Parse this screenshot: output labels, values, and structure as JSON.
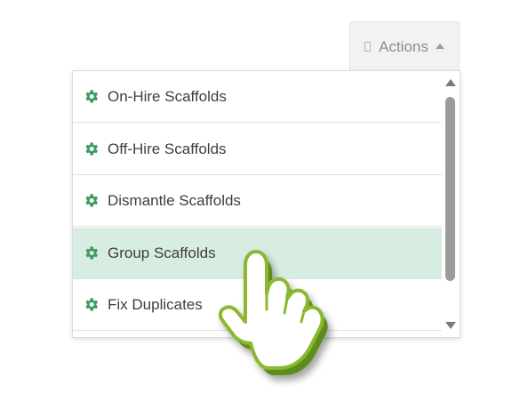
{
  "actions_button": {
    "label": "Actions",
    "icon": "document-icon",
    "caret": "caret-up-icon"
  },
  "menu": {
    "items": [
      {
        "label": "On-Hire Scaffolds",
        "icon": "gear-icon"
      },
      {
        "label": "Off-Hire Scaffolds",
        "icon": "gear-icon"
      },
      {
        "label": "Dismantle Scaffolds",
        "icon": "gear-icon"
      },
      {
        "label": "Group Scaffolds",
        "icon": "gear-icon",
        "highlighted": true
      },
      {
        "label": "Fix Duplicates",
        "icon": "gear-icon"
      }
    ]
  },
  "colors": {
    "gear": "#3f9b63",
    "highlight": "#d8ede1",
    "hand_fill": "#ffffff",
    "hand_outline": "#8ab82f"
  }
}
